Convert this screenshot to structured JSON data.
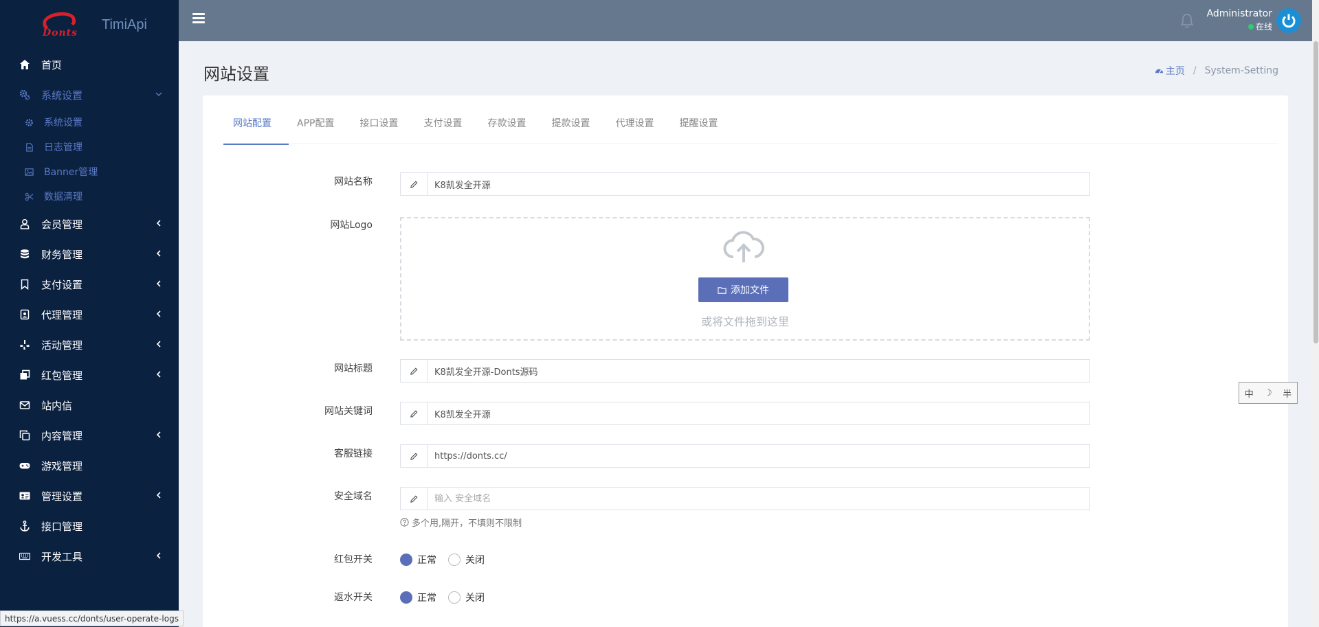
{
  "brand": {
    "logo_word": "Donts",
    "app_name": "TimiApi",
    "logo_color": "#d8202b"
  },
  "topbar": {
    "user_name": "Administrator",
    "user_status": "在线",
    "status_color": "#2ecc71",
    "bg_color": "#66788e"
  },
  "sidebar": {
    "items": [
      {
        "label": "首页",
        "icon": "home-icon"
      },
      {
        "label": "系统设置",
        "icon": "gears-icon",
        "expanded": true,
        "sub": [
          {
            "label": "系统设置",
            "icon": "gear-icon"
          },
          {
            "label": "日志管理",
            "icon": "file-icon"
          },
          {
            "label": "Banner管理",
            "icon": "image-icon"
          },
          {
            "label": "数据清理",
            "icon": "scissors-icon"
          }
        ]
      },
      {
        "label": "会员管理",
        "icon": "user-icon"
      },
      {
        "label": "财务管理",
        "icon": "database-icon"
      },
      {
        "label": "支付设置",
        "icon": "bookmark-icon"
      },
      {
        "label": "代理管理",
        "icon": "agent-icon"
      },
      {
        "label": "活动管理",
        "icon": "yelp-icon"
      },
      {
        "label": "红包管理",
        "icon": "clone-icon"
      },
      {
        "label": "站内信",
        "icon": "envelope-icon"
      },
      {
        "label": "内容管理",
        "icon": "copy-icon"
      },
      {
        "label": "游戏管理",
        "icon": "gamepad-icon"
      },
      {
        "label": "管理设置",
        "icon": "id-card-icon"
      },
      {
        "label": "接口管理",
        "icon": "anchor-icon"
      },
      {
        "label": "开发工具",
        "icon": "keyboard-icon"
      }
    ]
  },
  "page": {
    "title": "网站设置",
    "breadcrumb_home": "主页",
    "breadcrumb_current": "System-Setting"
  },
  "tabs": [
    "网站配置",
    "APP配置",
    "接口设置",
    "支付设置",
    "存款设置",
    "提款设置",
    "代理设置",
    "提醒设置"
  ],
  "form": {
    "site_name_label": "网站名称",
    "site_name_value": "K8凯发全开源",
    "logo_label": "网站Logo",
    "upload_button": "添加文件",
    "upload_hint": "或将文件拖到这里",
    "site_title_label": "网站标题",
    "site_title_value": "K8凯发全开源-Donts源码",
    "keywords_label": "网站关键词",
    "keywords_value": "K8凯发全开源",
    "service_link_label": "客服链接",
    "service_link_value": "https://donts.cc/",
    "safe_domain_label": "安全域名",
    "safe_domain_placeholder": "输入 安全域名",
    "safe_domain_help": "多个用,隔开，不填则不限制",
    "redpacket_label": "红包开关",
    "rebate_label": "返水开关",
    "opt_normal": "正常",
    "opt_close": "关闭"
  },
  "ime": {
    "a": "中",
    "b": "☽",
    "c": "半"
  },
  "statusbar_url": "https://a.vuess.cc/donts/user-operate-logs",
  "accent_color": "#5a79c6"
}
